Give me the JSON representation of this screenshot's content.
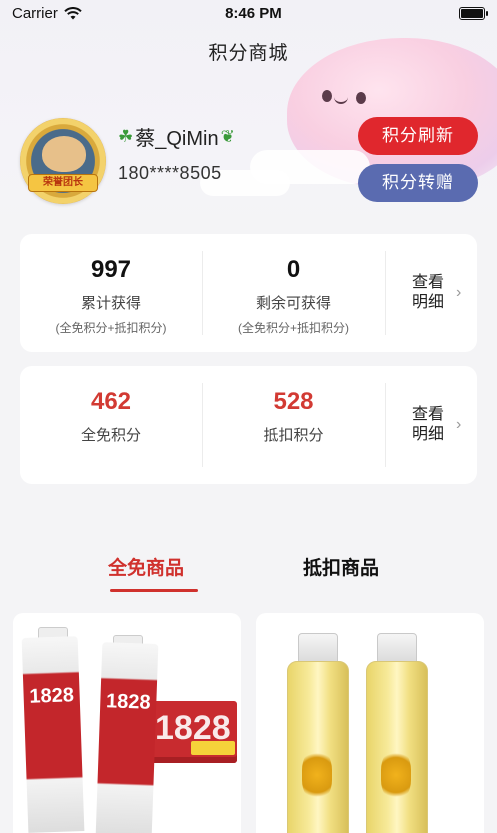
{
  "status_bar": {
    "carrier": "Carrier",
    "time": "8:46 PM"
  },
  "nav": {
    "title": "积分商城"
  },
  "profile": {
    "username": "蔡_QiMin",
    "phone": "180****8505",
    "badge_text": "荣誉团长",
    "refresh_label": "积分刷新",
    "transfer_label": "积分转赠"
  },
  "summary_card": {
    "total_earned_value": "997",
    "total_earned_label": "累计获得",
    "total_earned_note": "(全免积分+抵扣积分)",
    "remaining_value": "0",
    "remaining_label": "剩余可获得",
    "remaining_note": "(全免积分+抵扣积分)",
    "detail_label": "查看明细"
  },
  "points_card": {
    "free_value": "462",
    "free_label": "全免积分",
    "deduct_value": "528",
    "deduct_label": "抵扣积分",
    "detail_label": "查看明细"
  },
  "tabs": [
    {
      "label": "全免商品",
      "active": true
    },
    {
      "label": "抵扣商品",
      "active": false
    }
  ],
  "products": [
    {
      "image_text": "1828"
    },
    {
      "image_text": ""
    }
  ],
  "colors": {
    "accent_red": "#e0272d",
    "accent_blue": "#5a6bb0",
    "points_red": "#d23a33"
  }
}
